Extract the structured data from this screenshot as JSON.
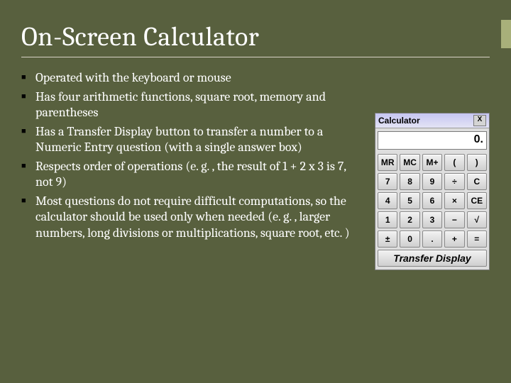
{
  "title": "On-Screen Calculator",
  "bullets": [
    "Operated with the keyboard or mouse",
    "Has four arithmetic functions, square root, memory and parentheses",
    "Has a Transfer Display button to transfer a number to a Numeric Entry question (with a single answer box)",
    "Respects order of operations (e. g. , the result of 1 + 2 x 3 is 7, not 9)",
    "Most questions do not require difficult computations, so the calculator should be used only when needed (e. g. , larger numbers, long divisions or multiplications, square root, etc. )"
  ],
  "calculator": {
    "titlebar": "Calculator",
    "close": "X",
    "display": "0.",
    "buttons": [
      "MR",
      "MC",
      "M+",
      "(",
      ")",
      "7",
      "8",
      "9",
      "÷",
      "C",
      "4",
      "5",
      "6",
      "×",
      "CE",
      "1",
      "2",
      "3",
      "−",
      "√",
      "±",
      "0",
      ".",
      "+",
      "="
    ],
    "transfer": "Transfer Display"
  }
}
